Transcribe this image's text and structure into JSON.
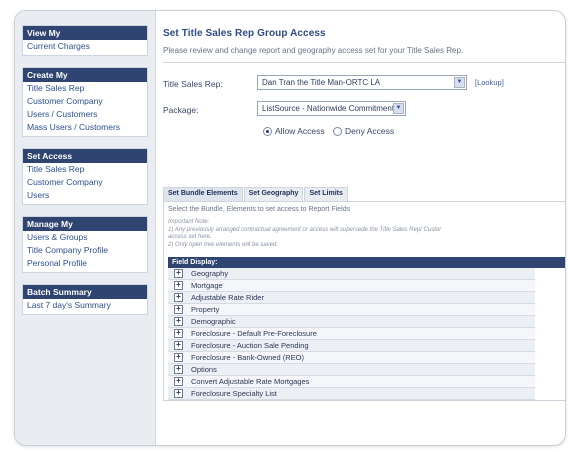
{
  "sidebar": {
    "groups": [
      {
        "title": "View My",
        "items": [
          "Current Charges"
        ]
      },
      {
        "title": "Create My",
        "items": [
          "Title Sales Rep",
          "Customer Company",
          "Users / Customers",
          "Mass Users / Customers"
        ]
      },
      {
        "title": "Set Access",
        "items": [
          "Title Sales Rep",
          "Customer Company",
          "Users"
        ]
      },
      {
        "title": "Manage My",
        "items": [
          "Users & Groups",
          "Title Company Profile",
          "Personal Profile"
        ]
      },
      {
        "title": "Batch Summary",
        "items": [
          "Last 7 day's Summary"
        ]
      }
    ]
  },
  "main": {
    "title": "Set Title Sales Rep Group Access",
    "subtitle": "Please review and change report and geography access set for your Title Sales Rep.",
    "rep_label": "Title Sales Rep:",
    "rep_value": "Dan Tran the Title Man-ORTC LA",
    "lookup_label": "[Lookup]",
    "package_label": "Package:",
    "package_value": "ListSource - Nationwide Commitment",
    "allow_label": "Allow Access",
    "deny_label": "Deny Access",
    "allow_selected": true
  },
  "panel": {
    "tabs": [
      "Set Bundle Elements",
      "Set Geography",
      "Set Limits"
    ],
    "active_tab": "Set Bundle Elements",
    "instruction": "Select the Bundle, Elements to set access to Report Fields",
    "note_title": "Important Note:",
    "note_line1": "1) Any previously arranged contractual agreement or access will supersede the Title Sales Rep/ Custor",
    "note_line2": "access set here.",
    "note_line3": "2) Only open tree elements will be saved.",
    "field_display_label": "Field Display:",
    "fields": [
      "Geography",
      "Mortgage",
      "Adjustable Rate Rider",
      "Property",
      "Demographic",
      "Foreclosure - Default Pre-Foreclosure",
      "Foreclosure - Auction Sale Pending",
      "Foreclosure - Bank-Owned (REO)",
      "Options",
      "Convert Adjustable Rate Mortgages",
      "Foreclosure Specialty List"
    ]
  },
  "icons": {
    "expand": "plus-box-icon",
    "dropdown": "chevron-down-icon"
  },
  "colors": {
    "sidebar_header": "#2f4471",
    "title": "#2d4b86",
    "link": "#2d4f93"
  }
}
